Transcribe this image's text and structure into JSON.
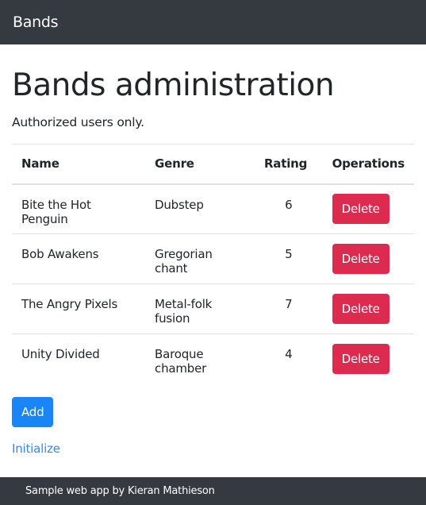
{
  "navbar": {
    "brand": "Bands"
  },
  "header": {
    "title": "Bands administration",
    "subtitle": "Authorized users only."
  },
  "table": {
    "columns": [
      "Name",
      "Genre",
      "Rating",
      "Operations"
    ],
    "rows": [
      {
        "name": "Bite the Hot Penguin",
        "genre": "Dubstep",
        "rating": "6",
        "action": "Delete"
      },
      {
        "name": "Bob Awakens",
        "genre": "Gregorian chant",
        "rating": "5",
        "action": "Delete"
      },
      {
        "name": "The Angry Pixels",
        "genre": "Metal-folk fusion",
        "rating": "7",
        "action": "Delete"
      },
      {
        "name": "Unity Divided",
        "genre": "Baroque chamber",
        "rating": "4",
        "action": "Delete"
      }
    ]
  },
  "actions": {
    "add_label": "Add",
    "initialize_label": "Initialize"
  },
  "footer": {
    "text": "Sample web app by Kieran Mathieson"
  },
  "colors": {
    "navbar": "#343a40",
    "danger": "#dc2b4e",
    "primary": "#1a86f6",
    "link": "#3389f1"
  }
}
